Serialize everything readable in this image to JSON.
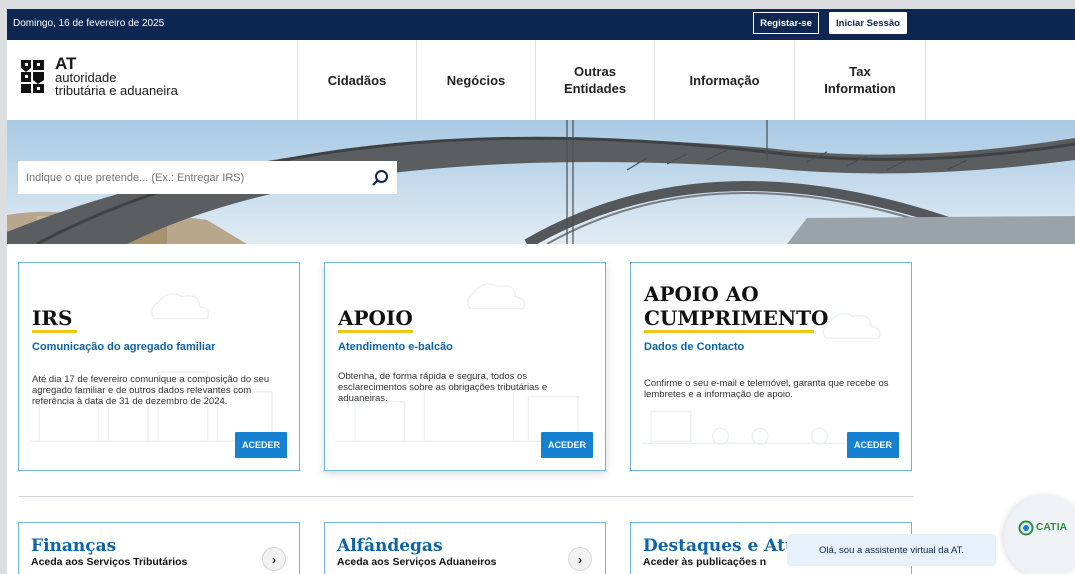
{
  "topbar": {
    "date": "Domingo, 16 de fevereiro de 2025",
    "register_label": "Registar-se",
    "login_label": "Iniciar Sessão"
  },
  "logo": {
    "line1": "AT",
    "line2": "autoridade",
    "line3": "tributária e aduaneira"
  },
  "nav": {
    "items": [
      {
        "label": "Cidadãos"
      },
      {
        "label": "Negócios"
      },
      {
        "label": "Outras\nEntidades"
      },
      {
        "label": "Informação"
      },
      {
        "label": "Tax\nInformation"
      }
    ]
  },
  "search": {
    "placeholder": "Indique o que pretende... (Ex.: Entregar IRS)"
  },
  "cards": [
    {
      "title": "IRS",
      "subtitle": "Comunicação do agregado familiar",
      "description": "Até dia 17 de fevereiro comunique a composição do seu agregado familiar e de outros dados relevantes com referência à data de 31 de dezembro de 2024.",
      "button": "ACEDER"
    },
    {
      "title": "APOIO",
      "subtitle": "Atendimento e-balcão",
      "description": "Obtenha, de forma rápida e segura, todos os esclarecimentos sobre as obrigações tributárias e aduaneiras.",
      "button": "ACEDER"
    },
    {
      "title": "APOIO AO CUMPRIMENTO",
      "title_line1": "APOIO AO",
      "title_line2": "CUMPRIMENTO",
      "subtitle": "Dados de Contacto",
      "description": "Confirme o seu e-mail e telemóvel, garanta que recebe os lembretes e a informação de apoio.",
      "button": "ACEDER"
    }
  ],
  "bottom_cards": [
    {
      "title": "Finanças",
      "subtitle": "Aceda aos Serviços Tributários"
    },
    {
      "title": "Alfândegas",
      "subtitle": "Aceda aos Serviços Aduaneiros"
    },
    {
      "title": "Destaques e Atu",
      "subtitle": "Aceder às publicações n"
    }
  ],
  "assistant": {
    "message": "Olá, sou a assistente virtual da AT.",
    "name": "CATIA"
  },
  "colors": {
    "topbar": "#0d2752",
    "accent_blue": "#1681d1",
    "link_blue": "#0d63a8",
    "underline_yellow": "#f4c518",
    "card_border": "#6fb5e0"
  }
}
